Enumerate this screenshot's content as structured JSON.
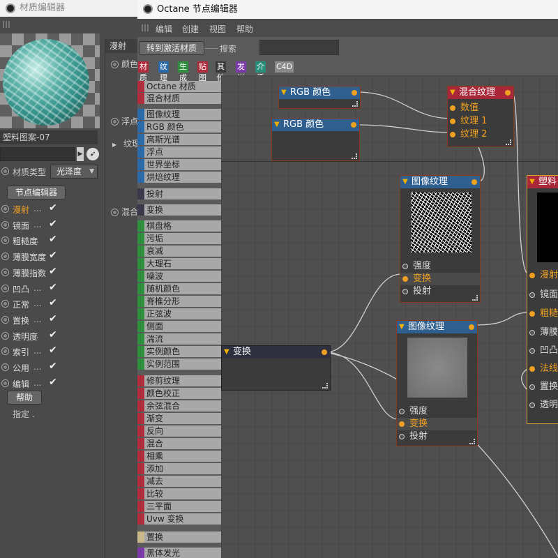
{
  "material_window": {
    "title": "材质编辑器",
    "material_name": "塑料图案-07",
    "type_label": "材质类型",
    "type_value": "光泽度",
    "node_editor_button": "节点编辑器",
    "channels": [
      {
        "label": "漫射",
        "dots": "...",
        "checked": "✔",
        "active": true
      },
      {
        "label": "镜面",
        "dots": "...",
        "checked": "✔",
        "active": false
      },
      {
        "label": "粗糙度",
        "dots": "..",
        "checked": "✔",
        "active": false
      },
      {
        "label": "薄膜宽度",
        "dots": "",
        "checked": "✔",
        "active": false
      },
      {
        "label": "薄膜指数",
        "dots": "",
        "checked": "✔",
        "active": false
      },
      {
        "label": "凹凸",
        "dots": "...",
        "checked": "✔",
        "active": false
      },
      {
        "label": "正常",
        "dots": "...",
        "checked": "✔",
        "active": false
      },
      {
        "label": "置换",
        "dots": "...",
        "checked": "✔",
        "active": false
      },
      {
        "label": "透明度",
        "dots": "..",
        "checked": "✔",
        "active": false
      },
      {
        "label": "索引",
        "dots": "...",
        "checked": "✔",
        "active": false
      },
      {
        "label": "公用",
        "dots": "...",
        "checked": "✔",
        "active": false
      },
      {
        "label": "编辑",
        "dots": "...",
        "checked": "✔",
        "active": false
      }
    ],
    "help_button": "帮助",
    "assign_label": "指定",
    "right_panel": {
      "header": "漫射",
      "items": [
        "颜色",
        "浮点",
        "纹理",
        "混合"
      ]
    }
  },
  "octane_window": {
    "title": "Octane 节点编辑器",
    "menus": [
      "编辑",
      "创建",
      "视图",
      "帮助"
    ],
    "goto_button": "转到激活材质",
    "search_label": "搜索",
    "category_tabs": [
      {
        "label": "材质",
        "color": "#b02c3c"
      },
      {
        "label": "纹理",
        "color": "#2a6aa8"
      },
      {
        "label": "生成",
        "color": "#2e8f3e"
      },
      {
        "label": "贴图",
        "color": "#b02c3c"
      },
      {
        "label": "其他",
        "color": "#3a3a3a"
      },
      {
        "label": "发光",
        "color": "#7a3aa8"
      },
      {
        "label": "介质",
        "color": "#2a8f7a"
      },
      {
        "label": "C4D",
        "color": "#8a8a8a"
      }
    ],
    "palette": [
      {
        "label": "Octane 材质",
        "color": "#b02c3c"
      },
      {
        "label": "混合材质",
        "color": "#b02c3c"
      },
      {
        "label": "图像纹理",
        "color": "#2a6aa8"
      },
      {
        "label": "RGB 颜色",
        "color": "#2a6aa8"
      },
      {
        "label": "高斯光谱",
        "color": "#2a6aa8"
      },
      {
        "label": "浮点",
        "color": "#2a6aa8"
      },
      {
        "label": "世界坐标",
        "color": "#2a6aa8"
      },
      {
        "label": "烘焙纹理",
        "color": "#2a6aa8"
      },
      {
        "label": "投射",
        "color": "#3a3a4a"
      },
      {
        "label": "变换",
        "color": "#3a3a4a"
      },
      {
        "label": "棋盘格",
        "color": "#2e8f3e"
      },
      {
        "label": "污垢",
        "color": "#2e8f3e"
      },
      {
        "label": "衰减",
        "color": "#2e8f3e"
      },
      {
        "label": "大理石",
        "color": "#2e8f3e"
      },
      {
        "label": "噪波",
        "color": "#2e8f3e"
      },
      {
        "label": "随机颜色",
        "color": "#2e8f3e"
      },
      {
        "label": "脊椎分形",
        "color": "#2e8f3e"
      },
      {
        "label": "正弦波",
        "color": "#2e8f3e"
      },
      {
        "label": "侧面",
        "color": "#2e8f3e"
      },
      {
        "label": "湍流",
        "color": "#2e8f3e"
      },
      {
        "label": "实例颜色",
        "color": "#2e8f3e"
      },
      {
        "label": "实例范围",
        "color": "#2e8f3e"
      },
      {
        "label": "修剪纹理",
        "color": "#b02c3c"
      },
      {
        "label": "颜色校正",
        "color": "#b02c3c"
      },
      {
        "label": "余弦混合",
        "color": "#b02c3c"
      },
      {
        "label": "渐变",
        "color": "#b02c3c"
      },
      {
        "label": "反向",
        "color": "#b02c3c"
      },
      {
        "label": "混合",
        "color": "#b02c3c"
      },
      {
        "label": "相乘",
        "color": "#b02c3c"
      },
      {
        "label": "添加",
        "color": "#b02c3c"
      },
      {
        "label": "减去",
        "color": "#b02c3c"
      },
      {
        "label": "比较",
        "color": "#b02c3c"
      },
      {
        "label": "三平面",
        "color": "#b02c3c"
      },
      {
        "label": "Uvw 变换",
        "color": "#b02c3c"
      },
      {
        "label": "置换",
        "color": "#c8b88a"
      },
      {
        "label": "黑体发光",
        "color": "#7a3aa8"
      }
    ],
    "nodes": {
      "rgb1": {
        "title": "RGB 颜色"
      },
      "rgb2": {
        "title": "RGB 颜色"
      },
      "mix": {
        "title": "混合纹理",
        "pins": [
          "数值",
          "纹理 1",
          "纹理 2"
        ]
      },
      "img1": {
        "title": "图像纹理",
        "pins": [
          "强度",
          "变换",
          "投射"
        ]
      },
      "img2": {
        "title": "图像纹理",
        "pins": [
          "强度",
          "变换",
          "投射"
        ]
      },
      "transform": {
        "title": "变换"
      },
      "material": {
        "title": "塑料",
        "pins": [
          "漫射",
          "镜面",
          "粗糙",
          "薄膜",
          "凹凸",
          "法线",
          "置换",
          "透明"
        ]
      }
    }
  }
}
